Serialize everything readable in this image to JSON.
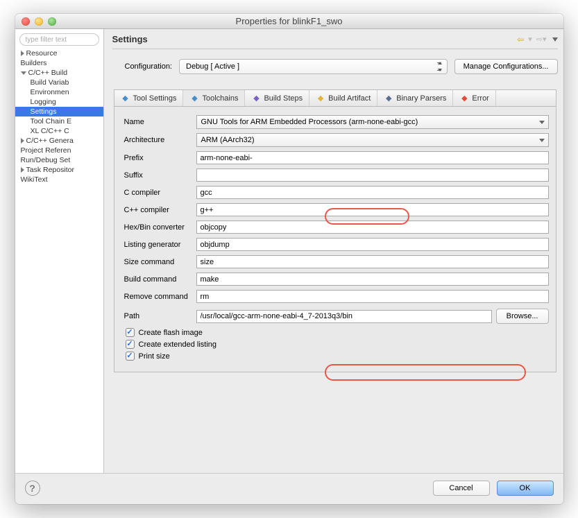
{
  "window": {
    "title": "Properties for blinkF1_swo"
  },
  "sidebar": {
    "filter_placeholder": "type filter text",
    "items": [
      {
        "label": "Resource",
        "kind": "expand-right",
        "lvl": 0
      },
      {
        "label": "Builders",
        "kind": "leaf",
        "lvl": 0
      },
      {
        "label": "C/C++ Build",
        "kind": "expand-down",
        "lvl": 0
      },
      {
        "label": "Build Variab",
        "kind": "leaf",
        "lvl": 1
      },
      {
        "label": "Environmen",
        "kind": "leaf",
        "lvl": 1
      },
      {
        "label": "Logging",
        "kind": "leaf",
        "lvl": 1
      },
      {
        "label": "Settings",
        "kind": "leaf",
        "lvl": 1,
        "selected": true
      },
      {
        "label": "Tool Chain E",
        "kind": "leaf",
        "lvl": 1
      },
      {
        "label": "XL C/C++ C",
        "kind": "leaf",
        "lvl": 1
      },
      {
        "label": "C/C++ Genera",
        "kind": "expand-right",
        "lvl": 0
      },
      {
        "label": "Project Referen",
        "kind": "leaf",
        "lvl": 0
      },
      {
        "label": "Run/Debug Set",
        "kind": "leaf",
        "lvl": 0
      },
      {
        "label": "Task Repositor",
        "kind": "expand-right",
        "lvl": 0
      },
      {
        "label": "WikiText",
        "kind": "leaf",
        "lvl": 0
      }
    ]
  },
  "header": {
    "title": "Settings"
  },
  "configuration": {
    "label": "Configuration:",
    "selected": "Debug  [ Active ]",
    "manage_btn": "Manage Configurations..."
  },
  "tabs": [
    {
      "label": "Tool Settings",
      "icon": "tool-settings-icon",
      "color": "#4a8ec8"
    },
    {
      "label": "Toolchains",
      "icon": "toolchains-icon",
      "color": "#4a8ec8",
      "active": true
    },
    {
      "label": "Build Steps",
      "icon": "build-steps-icon",
      "color": "#7a62c0"
    },
    {
      "label": "Build Artifact",
      "icon": "build-artifact-icon",
      "color": "#e3b43b"
    },
    {
      "label": "Binary Parsers",
      "icon": "binary-parsers-icon",
      "color": "#5a7090"
    },
    {
      "label": "Error",
      "icon": "error-parsers-icon",
      "color": "#e24a3b"
    }
  ],
  "form": {
    "name_label": "Name",
    "name_value": "GNU Tools for ARM Embedded Processors (arm-none-eabi-gcc)",
    "arch_label": "Architecture",
    "arch_value": "ARM (AArch32)",
    "prefix_label": "Prefix",
    "prefix_value": "arm-none-eabi-",
    "suffix_label": "Suffix",
    "suffix_value": "",
    "ccompiler_label": "C compiler",
    "ccompiler_value": "gcc",
    "cppcompiler_label": "C++ compiler",
    "cppcompiler_value": "g++",
    "hex_label": "Hex/Bin converter",
    "hex_value": "objcopy",
    "listing_label": "Listing generator",
    "listing_value": "objdump",
    "size_label": "Size command",
    "size_value": "size",
    "build_label": "Build command",
    "build_value": "make",
    "remove_label": "Remove command",
    "remove_value": "rm",
    "path_label": "Path",
    "path_value": "/usr/local/gcc-arm-none-eabi-4_7-2013q3/bin",
    "browse_btn": "Browse...",
    "chk_flash": "Create flash image",
    "chk_listing": "Create extended listing",
    "chk_size": "Print size"
  },
  "footer": {
    "cancel": "Cancel",
    "ok": "OK"
  }
}
